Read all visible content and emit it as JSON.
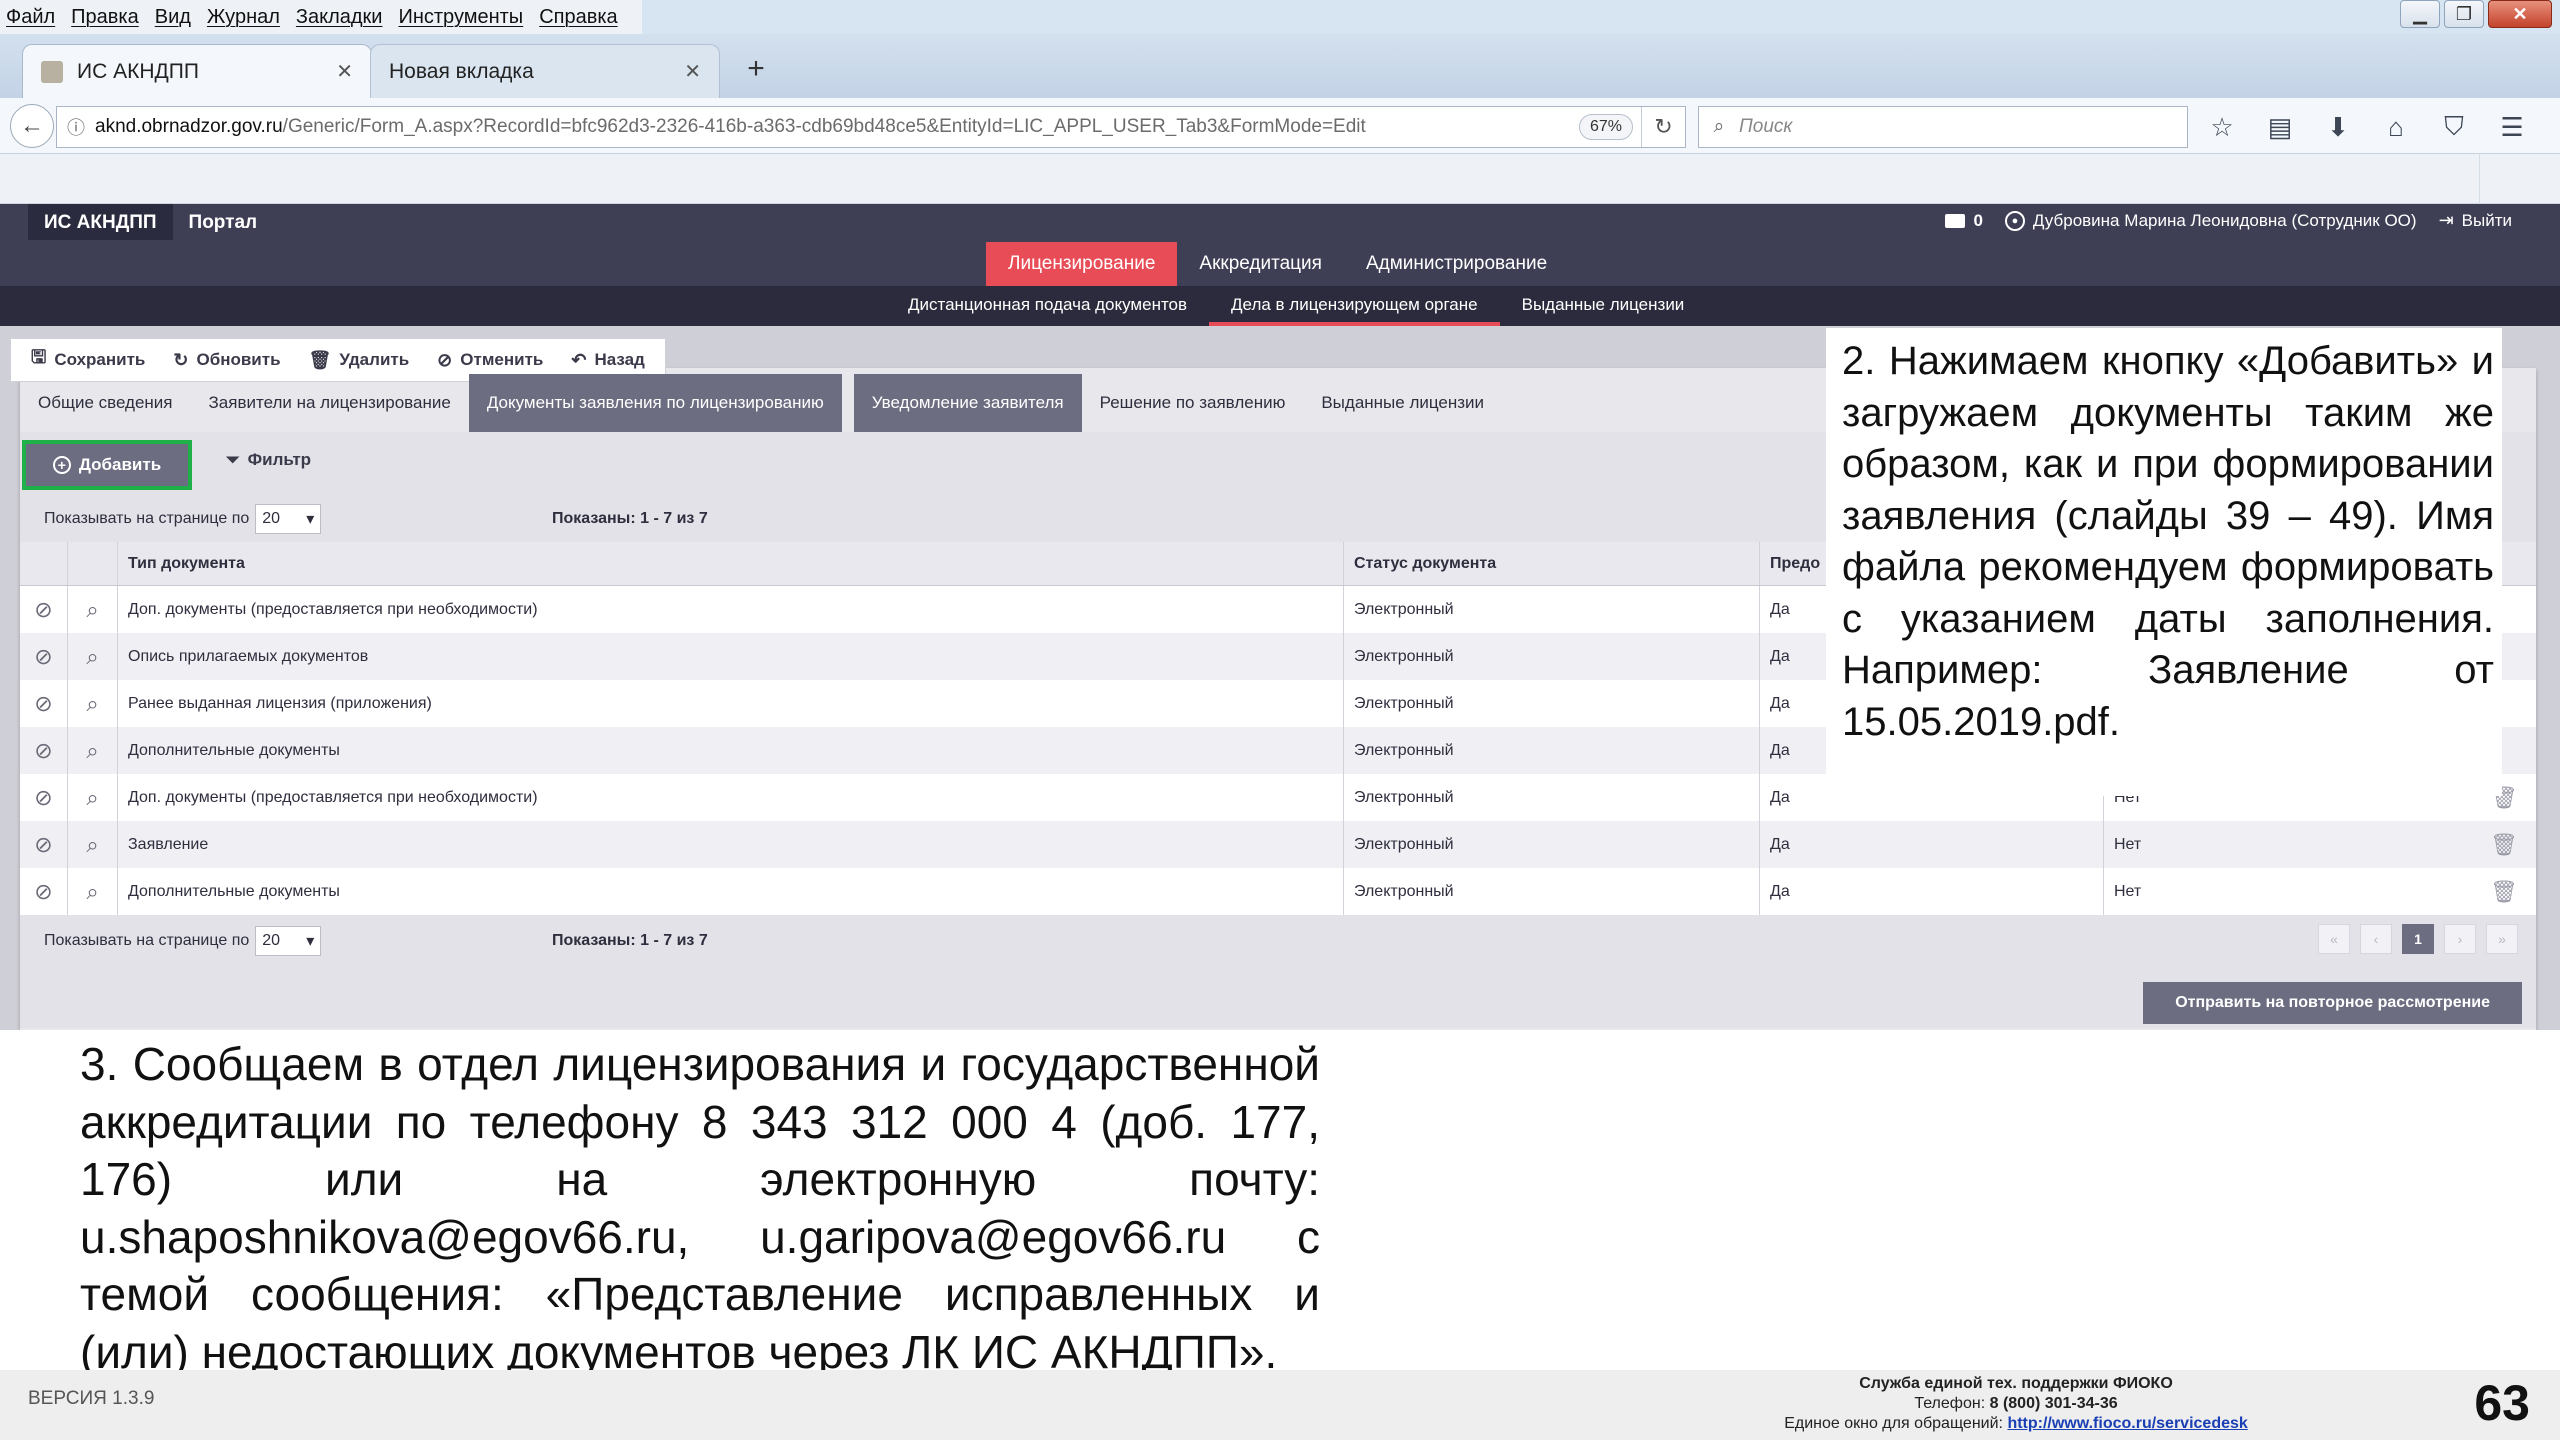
{
  "browser": {
    "menu": [
      "Файл",
      "Правка",
      "Вид",
      "Журнал",
      "Закладки",
      "Инструменты",
      "Справка"
    ],
    "tabs": [
      {
        "label": "ИС АКНДПП",
        "active": true
      },
      {
        "label": "Новая вкладка",
        "active": false
      }
    ],
    "url_host": "aknd.obrnadzor.gov.ru",
    "url_path": "/Generic/Form_A.aspx?RecordId=bfc962d3-2326-416b-a363-cdb69bd48ce5&EntityId=LIC_APPL_USER_Tab3&FormMode=Edit",
    "zoom": "67%",
    "search_placeholder": "Поиск"
  },
  "portal": {
    "brand": [
      "ИС АКНДПП",
      "Портал"
    ],
    "messages_count": "0",
    "user": "Дубровина Марина Леонидовна (Сотрудник ОО)",
    "logout": "Выйти",
    "main_tabs": [
      "Лицензирование",
      "Аккредитация",
      "Администрирование"
    ],
    "main_active": "Лицензирование",
    "sub_tabs": [
      "Дистанционная подача документов",
      "Дела в лицензирующем органе",
      "Выданные лицензии"
    ],
    "sub_active": "Дела в лицензирующем органе",
    "actions": [
      "Сохранить",
      "Обновить",
      "Удалить",
      "Отменить",
      "Назад"
    ],
    "form_tabs": [
      "Общие сведения",
      "Заявители на лицензирование",
      "Документы заявления по лицензированию",
      "Уведомление заявителя",
      "Решение по заявлению",
      "Выданные лицензии"
    ],
    "add_label": "Добавить",
    "filter_label": "Фильтр",
    "per_page_label": "Показывать на странице по",
    "per_page_value": "20",
    "shown_label": "Показаны: 1 - 7 из 7",
    "columns": [
      "Тип документа",
      "Статус документа",
      "Предо"
    ],
    "rows": [
      {
        "type": "Доп. документы (предоставляется при необходимости)",
        "status": "Электронный",
        "provided": "Да",
        "required": ""
      },
      {
        "type": "Опись прилагаемых документов",
        "status": "Электронный",
        "provided": "Да",
        "required": ""
      },
      {
        "type": "Ранее выданная лицензия (приложения)",
        "status": "Электронный",
        "provided": "Да",
        "required": ""
      },
      {
        "type": "Дополнительные документы",
        "status": "Электронный",
        "provided": "Да",
        "required": ""
      },
      {
        "type": "Доп. документы (предоставляется при необходимости)",
        "status": "Электронный",
        "provided": "Да",
        "required": "Нет"
      },
      {
        "type": "Заявление",
        "status": "Электронный",
        "provided": "Да",
        "required": "Нет"
      },
      {
        "type": "Дополнительные документы",
        "status": "Электронный",
        "provided": "Да",
        "required": "Нет"
      }
    ],
    "current_page": "1",
    "resend_label": "Отправить на повторное рассмотрение"
  },
  "slide": {
    "callout_2": "2. Нажимаем кнопку «Добавить» и загружаем документы таким же образом, как и при формировании заявления (слайды 39 – 49). Имя файла рекомендуем формировать с указанием даты заполнения. Например: Заявление от 15.05.2019.pdf.",
    "callout_3": "3. Сообщаем в отдел лицензирования и государственной аккредитации по телефону 8 343 312 000 4 (доб. 177, 176)                     или на электронную почту: u.shaposhnikova@egov66.ru, u.garipova@egov66.ru с темой сообщения: «Представление исправленных и (или) недостающих документов через ЛК ИС АКНДПП».",
    "version": "ВЕРСИЯ 1.3.9",
    "support_title": "Служба единой тех. поддержки ФИОКО",
    "support_phone_label": "Телефон:",
    "support_phone": "8 (800) 301-34-36",
    "support_window_label": "Единое окно для обращений:",
    "support_link": "http://www.fioco.ru/servicedesk",
    "slide_number": "63"
  },
  "colors": {
    "header_dark": "#3e3e55",
    "accent_red": "#e84c57",
    "button_gray": "#6c6d81",
    "add_border_green": "#1fb04a"
  }
}
